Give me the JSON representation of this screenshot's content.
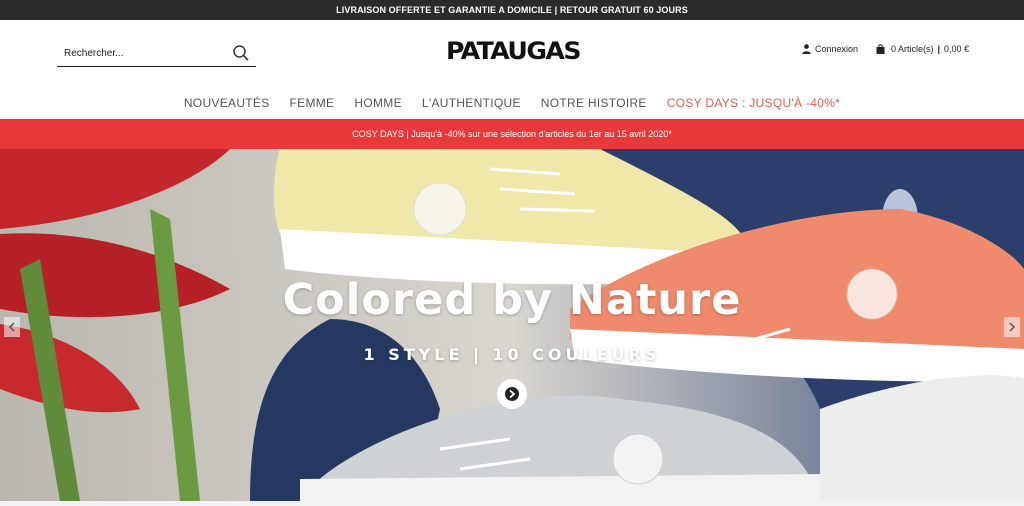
{
  "topbar": {
    "text": "LIVRAISON OFFERTE ET GARANTIE A DOMICILE | RETOUR GRATUIT 60 JOURS"
  },
  "search": {
    "placeholder": "Rechercher..."
  },
  "brand": {
    "logo_text": "PATAUGAS"
  },
  "account": {
    "label": "Connexion"
  },
  "cart": {
    "count_label": "0 Article(s)",
    "separator": "|",
    "total": "0,00 €"
  },
  "nav": {
    "items": [
      {
        "label": "NOUVEAUTÉS"
      },
      {
        "label": "FEMME"
      },
      {
        "label": "HOMME"
      },
      {
        "label": "L'AUTHENTIQUE"
      },
      {
        "label": "NOTRE HISTOIRE"
      },
      {
        "label": "COSY DAYS : JUSQU'À -40%*"
      }
    ]
  },
  "promo": {
    "text": "COSY DAYS | Jusqu'à -40% sur une sélection d'articles du 1er au 15 avril 2020*"
  },
  "hero": {
    "title": "Colored by Nature",
    "subtitle": "1 STYLE | 10 COULEURS"
  },
  "colors": {
    "promo_red": "#e8383a",
    "nav_promo": "#e8584f",
    "topbar_bg": "#2b2b2b"
  },
  "icons": [
    "search-icon",
    "user-icon",
    "bag-icon",
    "arrow-right-icon",
    "chevron-left-icon",
    "chevron-right-icon"
  ]
}
